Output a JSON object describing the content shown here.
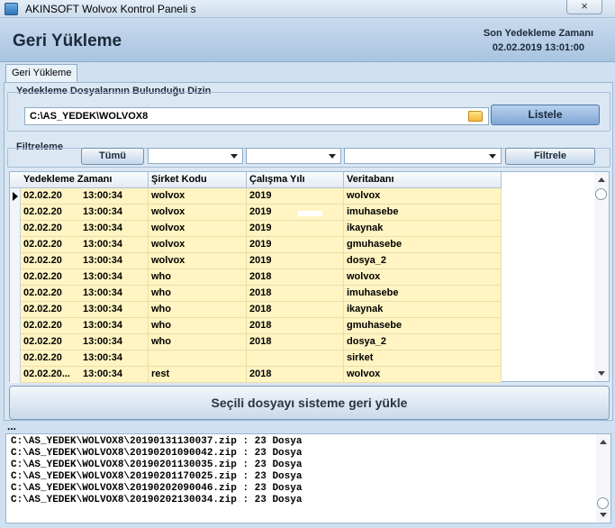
{
  "window": {
    "title": "AKINSOFT Wolvox Kontrol Paneli s",
    "close_glyph": "×"
  },
  "header": {
    "title": "Geri Yükleme",
    "last_backup_label": "Son Yedekleme Zamanı",
    "last_backup_value": "02.02.2019 13:01:00"
  },
  "tabs": [
    {
      "label": "Geri Yükleme",
      "active": true
    }
  ],
  "folder_group": {
    "label": "Yedekleme Dosyalarının Bulunduğu Dizin",
    "path": "C:\\AS_YEDEK\\WOLVOX8",
    "list_button": "Listele"
  },
  "filter_group": {
    "label": "Filtreleme",
    "all_button": "Tümü",
    "filter_button": "Filtrele"
  },
  "grid": {
    "columns": [
      "Yedekleme Zamanı",
      "Şirket Kodu",
      "Çalışma Yılı",
      "Veritabanı"
    ],
    "rows": [
      {
        "date": "02.02.20",
        "time": "13:00:34",
        "company": "wolvox",
        "year": "2019",
        "db": "wolvox"
      },
      {
        "date": "02.02.20",
        "time": "13:00:34",
        "company": "wolvox",
        "year": "2019",
        "db": "imuhasebe"
      },
      {
        "date": "02.02.20",
        "time": "13:00:34",
        "company": "wolvox",
        "year": "2019",
        "db": "ikaynak"
      },
      {
        "date": "02.02.20",
        "time": "13:00:34",
        "company": "wolvox",
        "year": "2019",
        "db": "gmuhasebe"
      },
      {
        "date": "02.02.20",
        "time": "13:00:34",
        "company": "wolvox",
        "year": "2019",
        "db": "dosya_2"
      },
      {
        "date": "02.02.20",
        "time": "13:00:34",
        "company": "who",
        "year": "2018",
        "db": "wolvox"
      },
      {
        "date": "02.02.20",
        "time": "13:00:34",
        "company": "who",
        "year": "2018",
        "db": "imuhasebe"
      },
      {
        "date": "02.02.20",
        "time": "13:00:34",
        "company": "who",
        "year": "2018",
        "db": "ikaynak"
      },
      {
        "date": "02.02.20",
        "time": "13:00:34",
        "company": "who",
        "year": "2018",
        "db": "gmuhasebe"
      },
      {
        "date": "02.02.20",
        "time": "13:00:34",
        "company": "who",
        "year": "2018",
        "db": "dosya_2"
      },
      {
        "date": "02.02.20",
        "time": "13:00:34",
        "company": "",
        "year": "",
        "db": "sirket"
      },
      {
        "date": "02.02.20...",
        "time": "13:00:34",
        "company": "rest",
        "year": "2018",
        "db": "wolvox"
      }
    ]
  },
  "restore_button": "Seçili dosyayı sisteme geri yükle",
  "log": {
    "ellipsis": "...",
    "lines": [
      "C:\\AS_YEDEK\\WOLVOX8\\20190131130037.zip : 23 Dosya",
      "C:\\AS_YEDEK\\WOLVOX8\\20190201090042.zip : 23 Dosya",
      "C:\\AS_YEDEK\\WOLVOX8\\20190201130035.zip : 23 Dosya",
      "C:\\AS_YEDEK\\WOLVOX8\\20190201170025.zip : 23 Dosya",
      "C:\\AS_YEDEK\\WOLVOX8\\20190202090046.zip : 23 Dosya",
      "C:\\AS_YEDEK\\WOLVOX8\\20190202130034.zip : 23 Dosya"
    ]
  }
}
